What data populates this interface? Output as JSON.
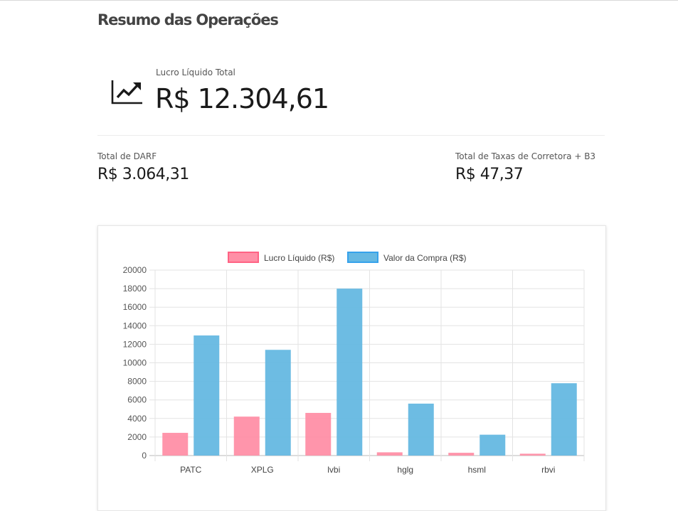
{
  "header": {
    "title": "Resumo das Operações"
  },
  "summary": {
    "net_profit_label": "Lucro Líquido Total",
    "net_profit_value": "R$ 12.304,61",
    "darf_label": "Total de DARF",
    "darf_value": "R$ 3.064,31",
    "fees_label": "Total de Taxas de Corretora + B3",
    "fees_value": "R$ 47,37"
  },
  "icons": {
    "hero": "trending-up-chart-icon"
  },
  "colors": {
    "profit": "#ff8fa6",
    "profit_border": "#ff6384",
    "purchase": "#65b8e2",
    "purchase_border": "#36a2eb"
  },
  "chart_data": {
    "type": "bar",
    "categories": [
      "PATC",
      "XPLG",
      "lvbi",
      "hglg",
      "hsml",
      "rbvi"
    ],
    "series": [
      {
        "name": "Lucro Líquido (R$)",
        "values": [
          2450,
          4200,
          4600,
          350,
          300,
          200
        ]
      },
      {
        "name": "Valor da Compra (R$)",
        "values": [
          12950,
          11400,
          18000,
          5600,
          2250,
          7800
        ]
      }
    ],
    "yticks": [
      "0",
      "2000",
      "4000",
      "6000",
      "8000",
      "10000",
      "12000",
      "14000",
      "16000",
      "18000",
      "20000"
    ],
    "ylim": [
      0,
      20000
    ],
    "grid": true,
    "legend": "top-center"
  }
}
